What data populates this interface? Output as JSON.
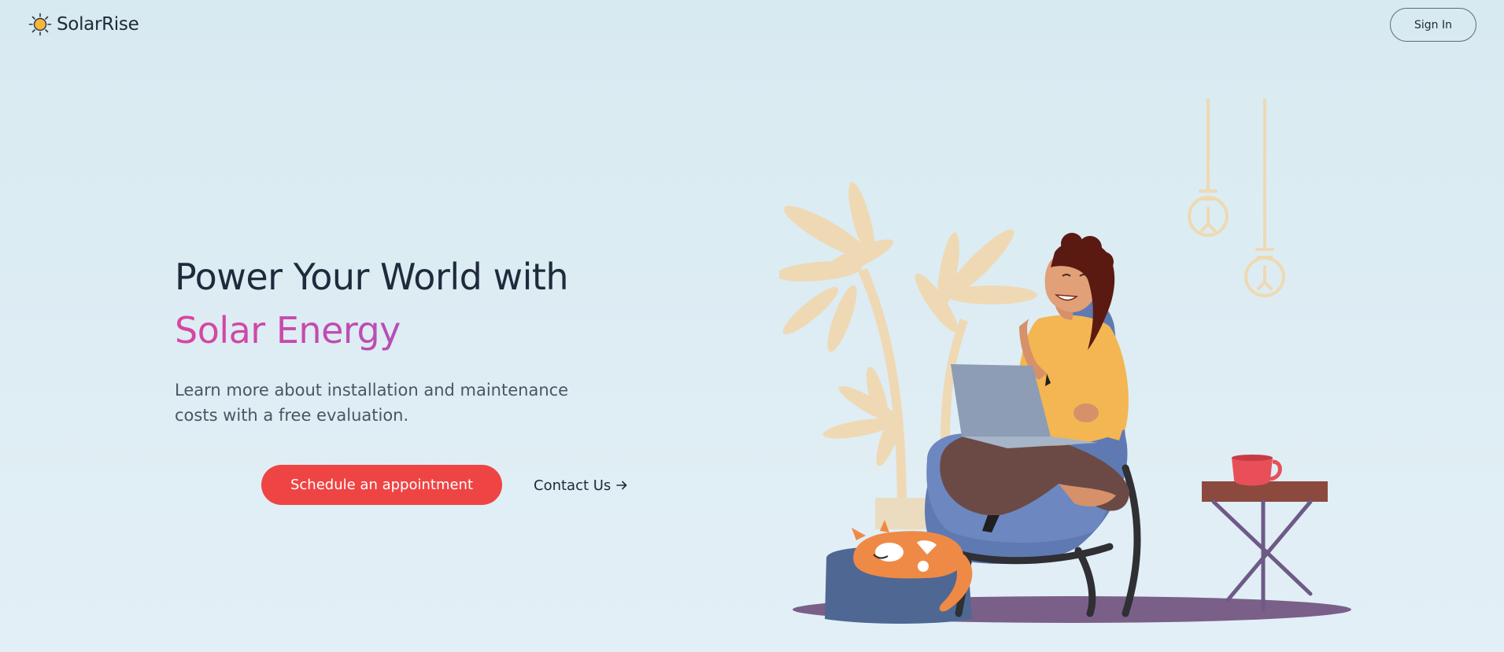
{
  "brand": {
    "name": "SolarRise",
    "logo_icon": "sun-icon",
    "accent": "#f4b73a"
  },
  "header": {
    "signin_label": "Sign In"
  },
  "hero": {
    "title_line1": "Power Your World with",
    "title_line2": "Solar Energy",
    "subtitle": "Learn more about installation and maintenance costs with a free evaluation.",
    "primary_cta": "Schedule an appointment",
    "secondary_cta": "Contact Us",
    "secondary_cta_icon": "arrow-right-icon",
    "gradient_colors": [
      "#d9469f",
      "#9b55c9"
    ],
    "primary_color": "#ef4444"
  },
  "illustration": {
    "description_icon": "woman-with-laptop-illustration"
  }
}
